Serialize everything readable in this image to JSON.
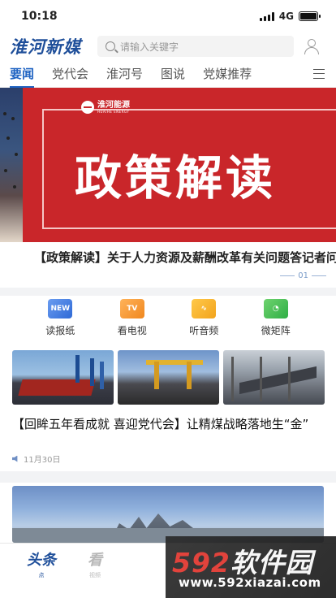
{
  "status_bar": {
    "time": "10:18",
    "network": "4G"
  },
  "header": {
    "logo_text": "淮河新媒",
    "search_placeholder": "请输入关键字"
  },
  "tabs": [
    {
      "label": "要闻",
      "active": true
    },
    {
      "label": "党代会",
      "active": false
    },
    {
      "label": "淮河号",
      "active": false
    },
    {
      "label": "图说",
      "active": false
    },
    {
      "label": "党媒推荐",
      "active": false
    }
  ],
  "banner": {
    "brand_name": "淮河能源",
    "brand_sub": "HUAIHE ENERGY",
    "title": "政策解读",
    "headline": "【政策解读】关于人力资源及薪酬改革有关问题答记者问",
    "pager": "01"
  },
  "quick_links": [
    {
      "label": "读报纸",
      "icon": "newspaper-icon",
      "glyph": "NEW"
    },
    {
      "label": "看电视",
      "icon": "tv-icon",
      "glyph": "TV"
    },
    {
      "label": "听音频",
      "icon": "audio-icon",
      "glyph": "∿"
    },
    {
      "label": "微矩阵",
      "icon": "wechat-icon",
      "glyph": "◔"
    }
  ],
  "article": {
    "title": "【回眸五年看成就 喜迎党代会】让精煤战略落地生“金”",
    "date": "11月30日"
  },
  "tabbar": [
    {
      "label": "头条",
      "sub": "点",
      "active": true
    },
    {
      "label": "看",
      "sub": "视频",
      "active": false
    }
  ],
  "watermark": {
    "brand_num": "592",
    "brand_text": "软件园",
    "url": "www.592xiazai.com"
  },
  "colors": {
    "accent": "#1f63c2",
    "banner_red": "#c9262a",
    "logo_blue": "#1f4f9a"
  }
}
